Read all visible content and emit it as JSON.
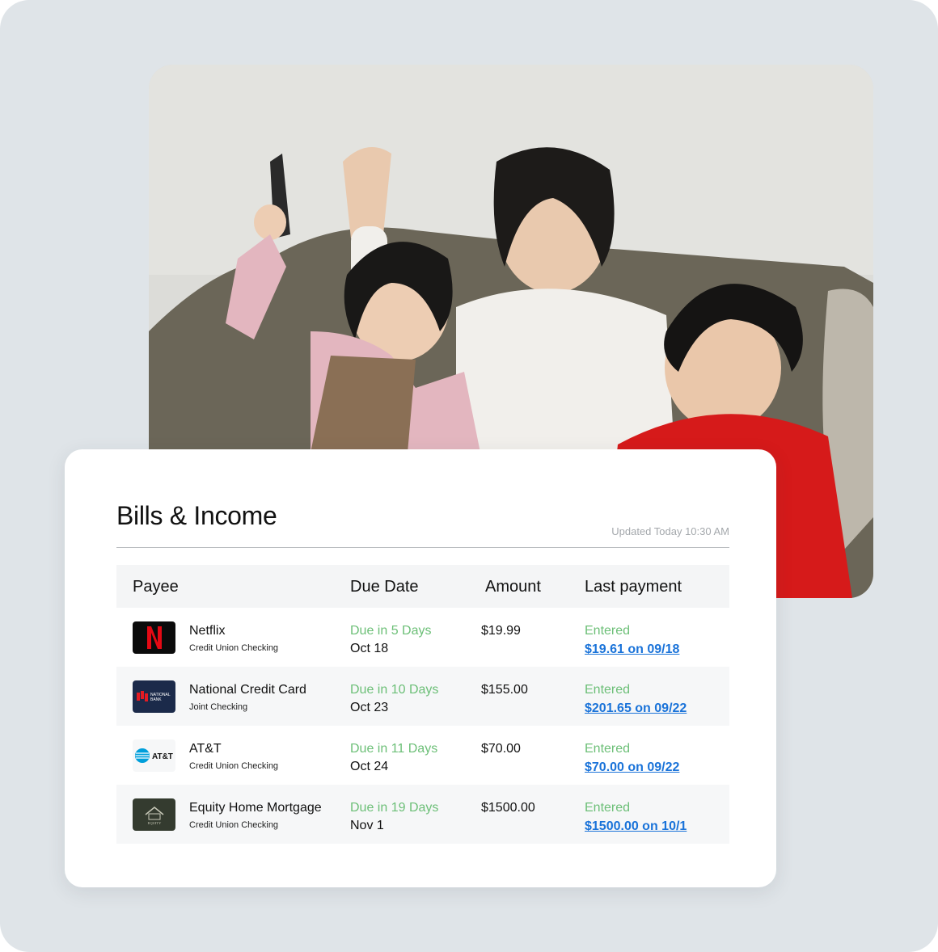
{
  "card": {
    "title": "Bills & Income",
    "updated": "Updated Today 10:30 AM"
  },
  "table": {
    "headers": {
      "payee": "Payee",
      "due_date": "Due Date",
      "amount": "Amount",
      "last_payment": "Last payment"
    },
    "rows": [
      {
        "payee": "Netflix",
        "account": "Credit Union Checking",
        "due_in": "Due in 5 Days",
        "due_date": "Oct 18",
        "amount": "$19.99",
        "status": "Entered",
        "last_payment": "$19.61 on 09/18",
        "logo_text": "N",
        "logo_icon": "netflix-logo",
        "logo_bg": "#0b0b0b",
        "logo_fg": "#e50914"
      },
      {
        "payee": "National Credit Card",
        "account": "Joint Checking",
        "due_in": "Due in 10 Days",
        "due_date": "Oct 23",
        "amount": "$155.00",
        "status": "Entered",
        "last_payment": "$201.65 on 09/22",
        "logo_text": "NATIONAL BANK",
        "logo_icon": "national-bank-logo",
        "logo_bg": "#1b2a4a",
        "logo_fg": "#e31b23"
      },
      {
        "payee": "AT&T",
        "account": "Credit Union Checking",
        "due_in": "Due in 11 Days",
        "due_date": "Oct 24",
        "amount": "$70.00",
        "status": "Entered",
        "last_payment": "$70.00 on 09/22",
        "logo_text": "AT&T",
        "logo_icon": "att-logo",
        "logo_bg": "#f6f7f8",
        "logo_fg": "#009fdb"
      },
      {
        "payee": "Equity Home Mortgage",
        "account": "Credit Union Checking",
        "due_in": "Due in 19 Days",
        "due_date": "Nov 1",
        "amount": "$1500.00",
        "status": "Entered",
        "last_payment": "$1500.00 on 10/1",
        "logo_text": "EQUITY",
        "logo_icon": "equity-house-logo",
        "logo_bg": "#343b2f",
        "logo_fg": "#c8c9b8"
      }
    ]
  },
  "colors": {
    "page_bg": "#dfe4e8",
    "due_green": "#6cbf77",
    "link_blue": "#1a73d9",
    "header_bg": "#f4f5f6"
  }
}
